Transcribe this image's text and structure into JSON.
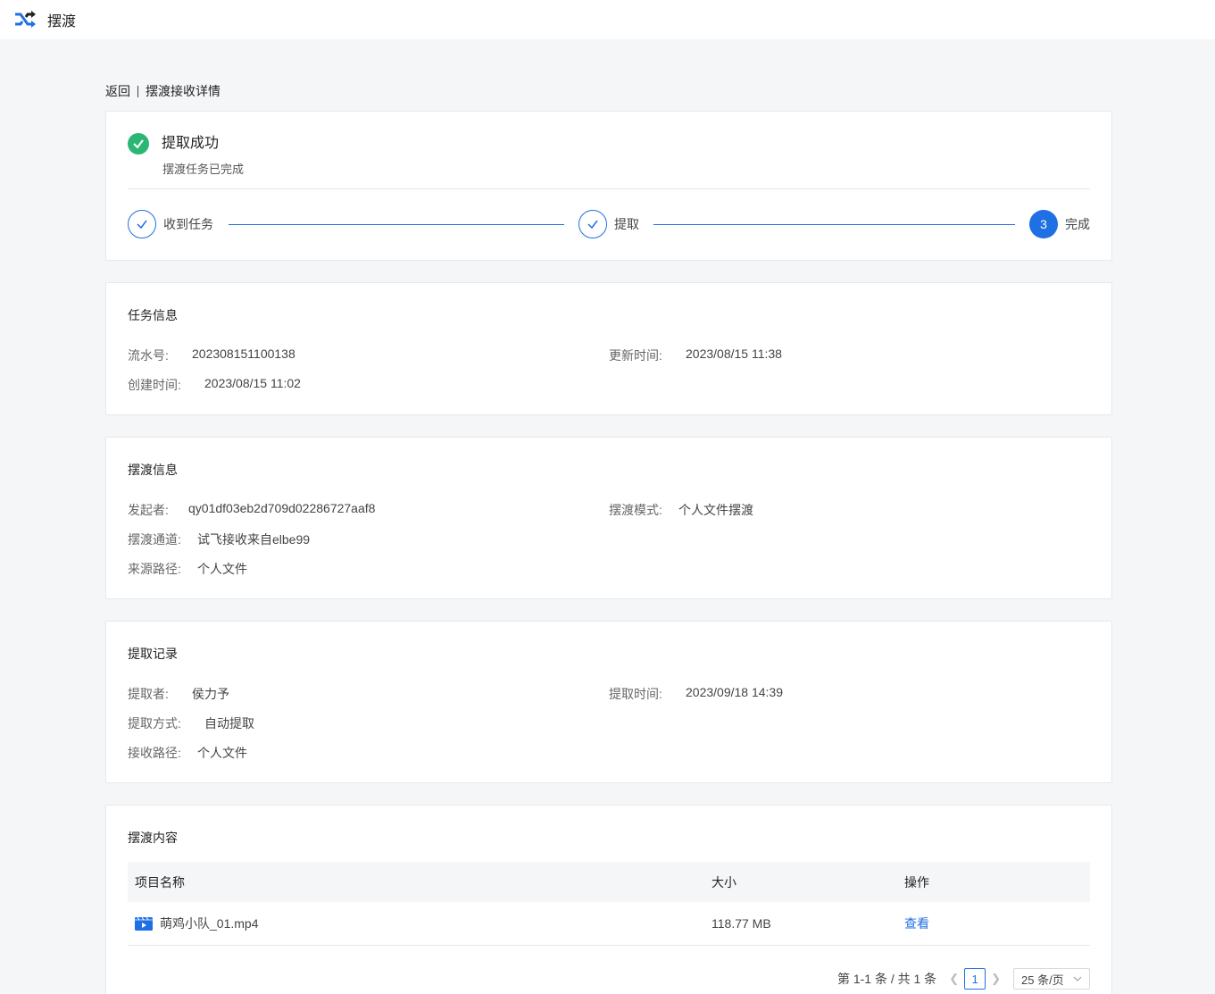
{
  "header": {
    "title": "摆渡",
    "logo_icon": "shuffle-icon",
    "accent": "#1f6fe5"
  },
  "breadcrumb": {
    "back": "返回",
    "current": "摆渡接收详情"
  },
  "status": {
    "icon": "check-circle-icon",
    "title": "提取成功",
    "subtitle": "摆渡任务已完成",
    "steps": [
      {
        "label": "收到任务",
        "state": "done"
      },
      {
        "label": "提取",
        "state": "done"
      },
      {
        "label": "完成",
        "state": "active",
        "number": "3"
      }
    ]
  },
  "task_info": {
    "title": "任务信息",
    "serial_label": "流水号:",
    "serial_value": "202308151100138",
    "updated_label": "更新时间:",
    "updated_value": "2023/08/15 11:38",
    "created_label": "创建时间:",
    "created_value": "2023/08/15 11:02"
  },
  "ferry_info": {
    "title": "摆渡信息",
    "initiator_label": "发起者:",
    "initiator_value": "qy01df03eb2d709d02286727aaf8",
    "mode_label": "摆渡模式:",
    "mode_value": "个人文件摆渡",
    "channel_label": "摆渡通道:",
    "channel_value": "试飞接收来自elbe99",
    "source_label": "来源路径:",
    "source_value": "个人文件"
  },
  "extract_record": {
    "title": "提取记录",
    "extractor_label": "提取者:",
    "extractor_value": "侯力予",
    "time_label": "提取时间:",
    "time_value": "2023/09/18 14:39",
    "method_label": "提取方式:",
    "method_value": "自动提取",
    "path_label": "接收路径:",
    "path_value": "个人文件"
  },
  "content": {
    "title": "摆渡内容",
    "columns": [
      "项目名称",
      "大小",
      "操作"
    ],
    "rows": [
      {
        "icon": "video-file-icon",
        "name": "萌鸡小队_01.mp4",
        "size": "118.77 MB",
        "action": "查看"
      }
    ],
    "pagination": {
      "summary": "第 1-1 条 / 共 1 条",
      "current_page": "1",
      "page_size": "25 条/页"
    }
  }
}
